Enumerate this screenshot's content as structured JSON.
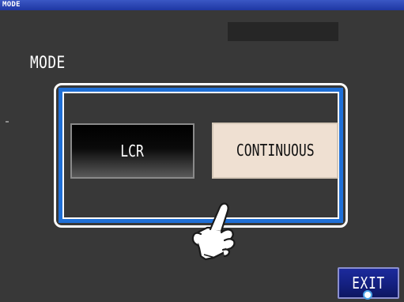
{
  "window": {
    "title": "MODE"
  },
  "main": {
    "section_label": "MODE",
    "options": [
      {
        "label": "LCR",
        "selected": false
      },
      {
        "label": "CONTINUOUS",
        "selected": true
      }
    ]
  },
  "footer": {
    "exit_label": "EXIT"
  },
  "colors": {
    "background": "#383838",
    "titlebar": "#1f37a3",
    "highlight_frame": "#1f6fd6",
    "selected_button": "#efe0d2",
    "exit_button": "#142080"
  },
  "icons": {
    "pointer": "hand-pointer-icon",
    "touch": "touch-indicator-icon"
  }
}
